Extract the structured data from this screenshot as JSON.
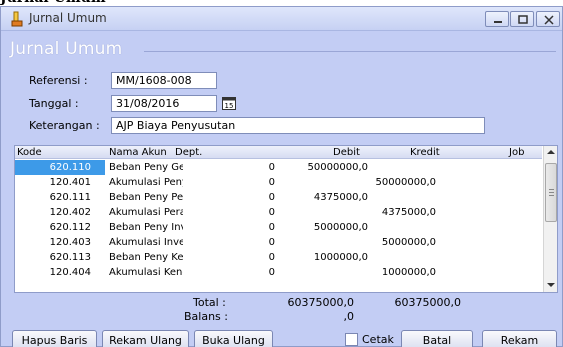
{
  "window": {
    "title": "Jurnal Umum",
    "panel_title": "Jurnal Umum"
  },
  "form": {
    "referensi_label": "Referensi :",
    "referensi_value": "MM/1608-008",
    "tanggal_label": "Tanggal :",
    "tanggal_value": "31/08/2016",
    "calendar_label": "15",
    "keterangan_label": "Keterangan :",
    "keterangan_value": "AJP Biaya Penyusutan"
  },
  "table": {
    "headers": [
      "Kode",
      "Nama Akun",
      "Dept.",
      "Debit",
      "Kredit",
      "Job"
    ],
    "rows": [
      {
        "kode": "620.110",
        "nama": "Beban Peny Gec",
        "dept": "0",
        "debit": "50000000,0",
        "kredit": ""
      },
      {
        "kode": "120.401",
        "nama": "Akumulasi Penyı",
        "dept": "0",
        "debit": "",
        "kredit": "50000000,0"
      },
      {
        "kode": "620.111",
        "nama": "Beban Peny Per",
        "dept": "0",
        "debit": "4375000,0",
        "kredit": ""
      },
      {
        "kode": "120.402",
        "nama": "Akumulasi Perala",
        "dept": "0",
        "debit": "",
        "kredit": "4375000,0"
      },
      {
        "kode": "620.112",
        "nama": "Beban Peny Inv",
        "dept": "0",
        "debit": "5000000,0",
        "kredit": ""
      },
      {
        "kode": "120.403",
        "nama": "Akumulasi Inver",
        "dept": "0",
        "debit": "",
        "kredit": "5000000,0"
      },
      {
        "kode": "620.113",
        "nama": "Beban Peny Ker",
        "dept": "0",
        "debit": "1000000,0",
        "kredit": ""
      },
      {
        "kode": "120.404",
        "nama": "Akumulasi Kenda",
        "dept": "0",
        "debit": "",
        "kredit": "1000000,0"
      }
    ]
  },
  "totals": {
    "total_label": "Total :",
    "total_debit": "60375000,0",
    "total_kredit": "60375000,0",
    "balans_label": "Balans :",
    "balans_value": ",0"
  },
  "buttons": {
    "hapus_baris": "Hapus Baris",
    "rekam_ulang": "Rekam Ulang",
    "buka_ulang": "Buka Ulang",
    "cetak": "Cetak",
    "batal": "Batal",
    "rekam": "Rekam"
  },
  "colors": {
    "window_bg": "#c3cdf4",
    "selection": "#3d9ae8"
  },
  "icons": {
    "app": "app-icon",
    "minimize": "minimize-icon",
    "maximize": "maximize-icon",
    "close": "close-icon",
    "calendar": "calendar-icon"
  }
}
